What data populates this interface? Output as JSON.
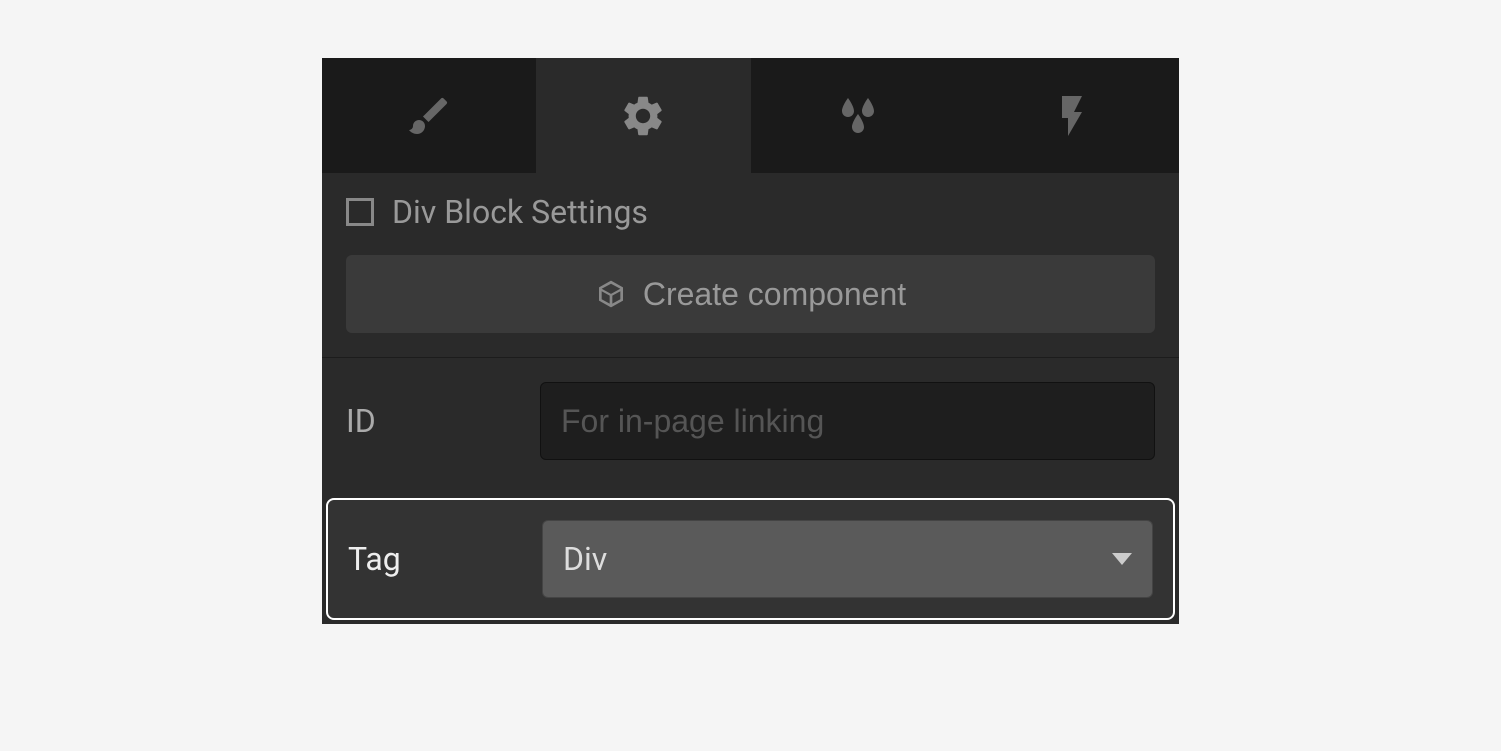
{
  "tabs": {
    "style": {
      "icon": "brush"
    },
    "settings": {
      "icon": "gear",
      "active": true
    },
    "effects": {
      "icon": "droplets"
    },
    "interactions": {
      "icon": "bolt"
    }
  },
  "header": {
    "title": "Div Block Settings"
  },
  "createComponent": {
    "label": "Create component"
  },
  "fields": {
    "id": {
      "label": "ID",
      "placeholder": "For in-page linking",
      "value": ""
    },
    "tag": {
      "label": "Tag",
      "selected": "Div"
    }
  }
}
